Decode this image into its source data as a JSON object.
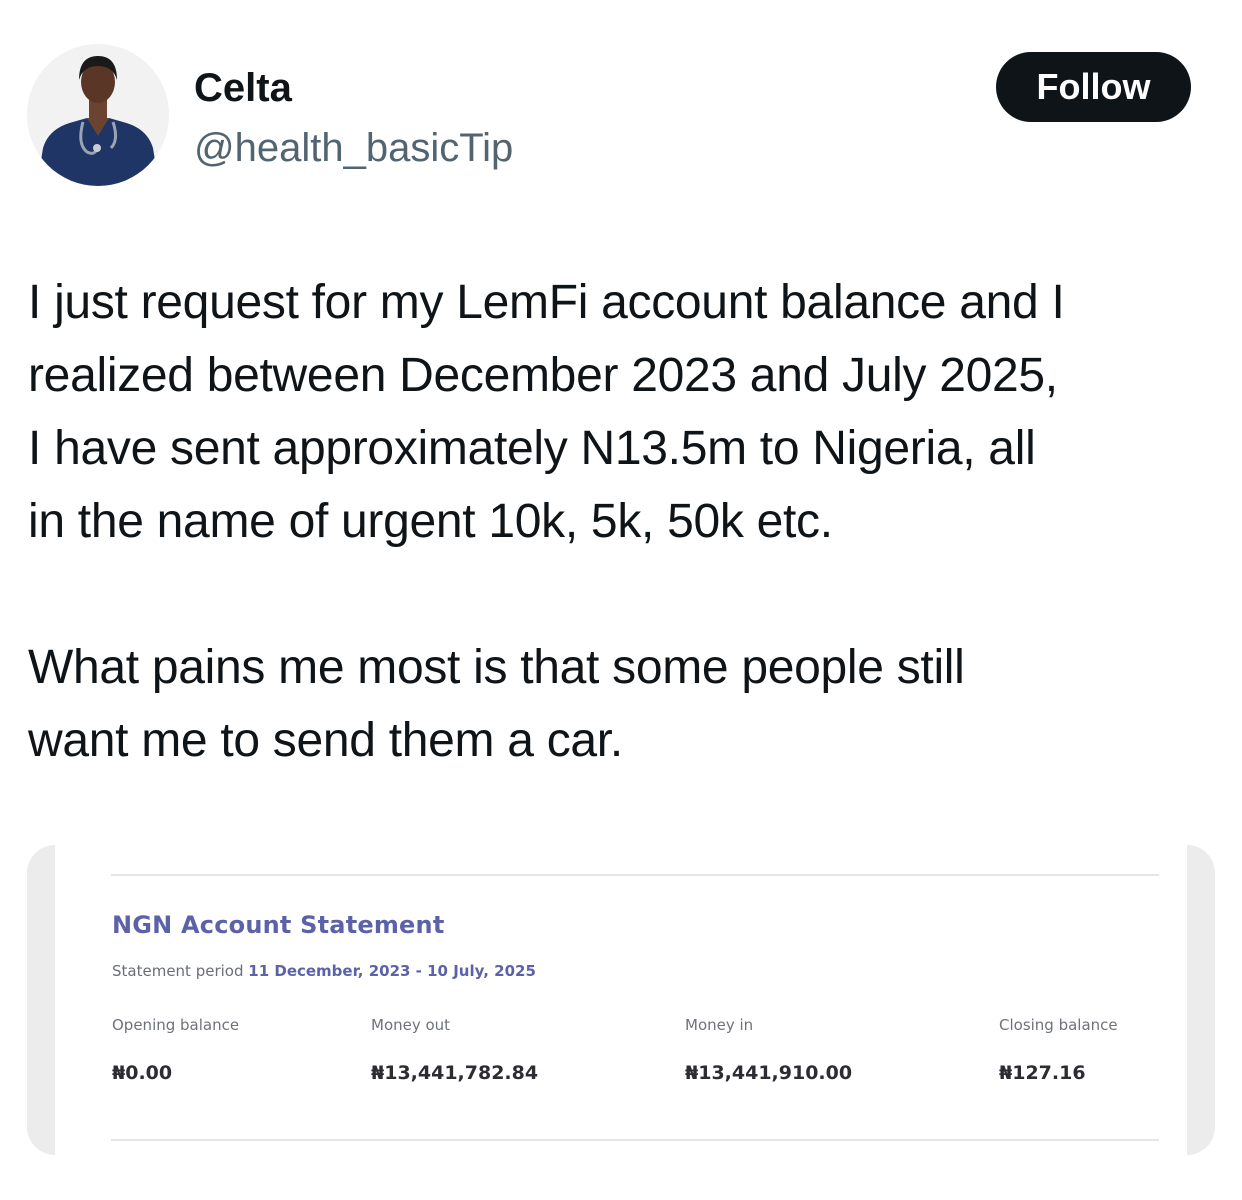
{
  "tweet": {
    "author": {
      "display_name": "Celta",
      "handle": "@health_basicTip",
      "avatar_icon": "profile-photo-nurse"
    },
    "follow_label": "Follow",
    "text_paragraphs": [
      "I just request for my LemFi account balance and I\nrealized between December 2023 and July 2025,\nI have sent approximately N13.5m to Nigeria, all\nin the name of urgent 10k, 5k, 50k etc.",
      "What pains me most is that some people still\nwant me to send them a car."
    ]
  },
  "statement": {
    "title": "NGN Account Statement",
    "period_label": "Statement period",
    "period_range": "11 December, 2023 - 10 July, 2025",
    "summary": [
      {
        "label": "Opening balance",
        "value": "₦0.00"
      },
      {
        "label": "Money out",
        "value": "₦13,441,782.84"
      },
      {
        "label": "Money in",
        "value": "₦13,441,910.00"
      },
      {
        "label": "Closing balance",
        "value": "₦127.16"
      }
    ]
  },
  "colors": {
    "text_primary": "#0f1419",
    "text_secondary": "#536471",
    "follow_bg": "#0f1419",
    "statement_accent": "#5c62a8"
  }
}
